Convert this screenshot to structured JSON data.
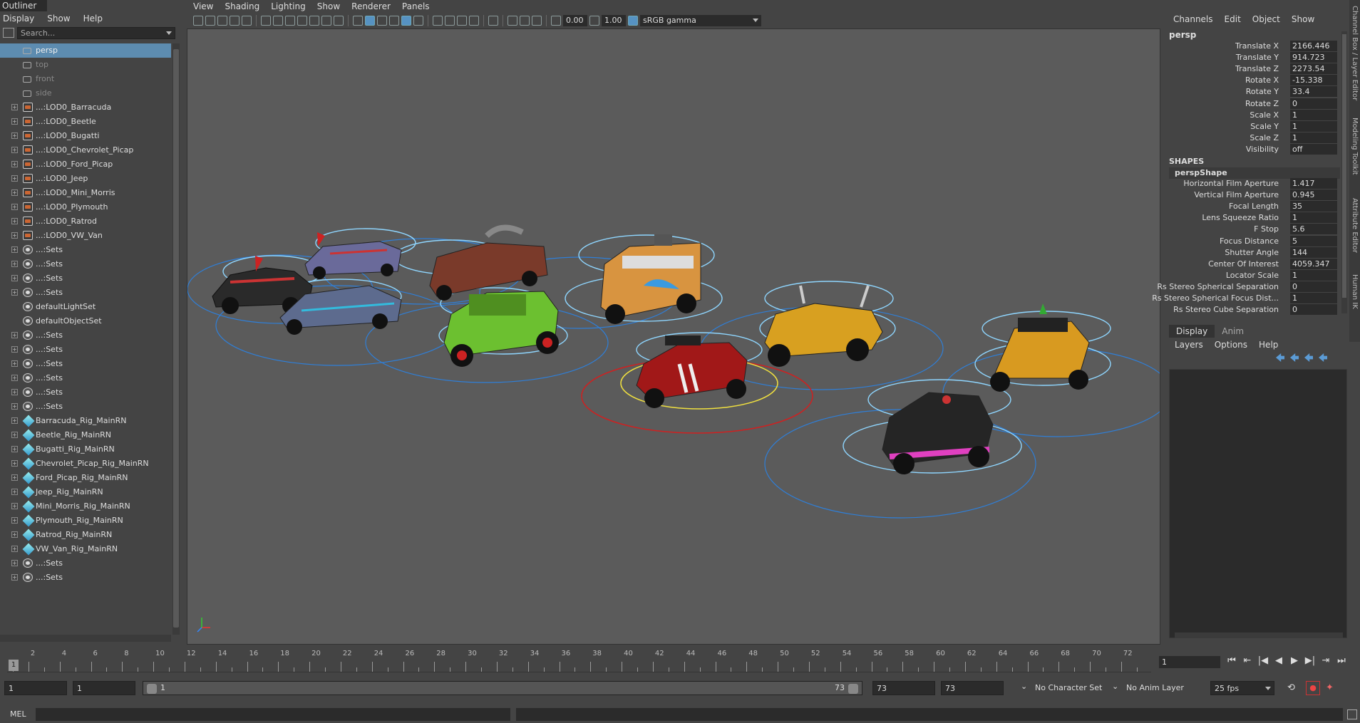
{
  "outliner": {
    "title": "Outliner",
    "menu": [
      "Display",
      "Show",
      "Help"
    ],
    "search_placeholder": "Search...",
    "items": [
      {
        "label": "persp",
        "icon": "camera-icon",
        "expand": false,
        "state": "selected"
      },
      {
        "label": "top",
        "icon": "camera-icon",
        "expand": false,
        "state": "dim"
      },
      {
        "label": "front",
        "icon": "camera-icon",
        "expand": false,
        "state": "dim"
      },
      {
        "label": "side",
        "icon": "camera-icon",
        "expand": false,
        "state": "dim"
      },
      {
        "label": "...:LOD0_Barracuda",
        "icon": "group-icon",
        "expand": true
      },
      {
        "label": "...:LOD0_Beetle",
        "icon": "group-icon",
        "expand": true
      },
      {
        "label": "...:LOD0_Bugatti",
        "icon": "group-icon",
        "expand": true
      },
      {
        "label": "...:LOD0_Chevrolet_Picap",
        "icon": "group-icon",
        "expand": true
      },
      {
        "label": "...:LOD0_Ford_Picap",
        "icon": "group-icon",
        "expand": true
      },
      {
        "label": "...:LOD0_Jeep",
        "icon": "group-icon",
        "expand": true
      },
      {
        "label": "...:LOD0_Mini_Morris",
        "icon": "group-icon",
        "expand": true
      },
      {
        "label": "...:LOD0_Plymouth",
        "icon": "group-icon",
        "expand": true
      },
      {
        "label": "...:LOD0_Ratrod",
        "icon": "group-icon",
        "expand": true
      },
      {
        "label": "...:LOD0_VW_Van",
        "icon": "group-icon",
        "expand": true
      },
      {
        "label": "...:Sets",
        "icon": "set-icon",
        "expand": true
      },
      {
        "label": "...:Sets",
        "icon": "set-icon",
        "expand": true
      },
      {
        "label": "...:Sets",
        "icon": "set-icon",
        "expand": true
      },
      {
        "label": "...:Sets",
        "icon": "set-icon",
        "expand": true
      },
      {
        "label": "defaultLightSet",
        "icon": "set-icon",
        "expand": false
      },
      {
        "label": "defaultObjectSet",
        "icon": "set-icon",
        "expand": false
      },
      {
        "label": "...:Sets",
        "icon": "set-icon",
        "expand": true
      },
      {
        "label": "...:Sets",
        "icon": "set-icon",
        "expand": true
      },
      {
        "label": "...:Sets",
        "icon": "set-icon",
        "expand": true
      },
      {
        "label": "...:Sets",
        "icon": "set-icon",
        "expand": true
      },
      {
        "label": "...:Sets",
        "icon": "set-icon",
        "expand": true
      },
      {
        "label": "...:Sets",
        "icon": "set-icon",
        "expand": true
      },
      {
        "label": "Barracuda_Rig_MainRN",
        "icon": "reference-icon",
        "expand": true
      },
      {
        "label": "Beetle_Rig_MainRN",
        "icon": "reference-icon",
        "expand": true
      },
      {
        "label": "Bugatti_Rig_MainRN",
        "icon": "reference-icon",
        "expand": true
      },
      {
        "label": "Chevrolet_Picap_Rig_MainRN",
        "icon": "reference-icon",
        "expand": true
      },
      {
        "label": "Ford_Picap_Rig_MainRN",
        "icon": "reference-icon",
        "expand": true
      },
      {
        "label": "Jeep_Rig_MainRN",
        "icon": "reference-icon",
        "expand": true
      },
      {
        "label": "Mini_Morris_Rig_MainRN",
        "icon": "reference-icon",
        "expand": true
      },
      {
        "label": "Plymouth_Rig_MainRN",
        "icon": "reference-icon",
        "expand": true
      },
      {
        "label": "Ratrod_Rig_MainRN",
        "icon": "reference-icon",
        "expand": true
      },
      {
        "label": "VW_Van_Rig_MainRN",
        "icon": "reference-icon",
        "expand": true
      },
      {
        "label": "...:Sets",
        "icon": "set-icon",
        "expand": true
      },
      {
        "label": "...:Sets",
        "icon": "set-icon",
        "expand": true
      }
    ]
  },
  "viewport": {
    "menu": [
      "View",
      "Shading",
      "Lighting",
      "Show",
      "Renderer",
      "Panels"
    ],
    "exposure": "0.00",
    "gamma": "1.00",
    "color_space": "sRGB gamma"
  },
  "channel_box": {
    "menu": [
      "Channels",
      "Edit",
      "Object",
      "Show"
    ],
    "node": "persp",
    "attributes": [
      {
        "name": "Translate X",
        "value": "2166.446"
      },
      {
        "name": "Translate Y",
        "value": "914.723"
      },
      {
        "name": "Translate Z",
        "value": "2273.54"
      },
      {
        "name": "Rotate X",
        "value": "-15.338"
      },
      {
        "name": "Rotate Y",
        "value": "33.4"
      },
      {
        "name": "Rotate Z",
        "value": "0"
      },
      {
        "name": "Scale X",
        "value": "1"
      },
      {
        "name": "Scale Y",
        "value": "1"
      },
      {
        "name": "Scale Z",
        "value": "1"
      },
      {
        "name": "Visibility",
        "value": "off"
      }
    ],
    "shapes_label": "SHAPES",
    "shape_node": "perspShape",
    "shape_attributes": [
      {
        "name": "Horizontal Film Aperture",
        "value": "1.417"
      },
      {
        "name": "Vertical Film Aperture",
        "value": "0.945"
      },
      {
        "name": "Focal Length",
        "value": "35"
      },
      {
        "name": "Lens Squeeze Ratio",
        "value": "1"
      },
      {
        "name": "F Stop",
        "value": "5.6"
      },
      {
        "name": "Focus Distance",
        "value": "5"
      },
      {
        "name": "Shutter Angle",
        "value": "144"
      },
      {
        "name": "Center Of Interest",
        "value": "4059.347"
      },
      {
        "name": "Locator Scale",
        "value": "1"
      },
      {
        "name": "Rs Stereo Spherical Separation",
        "value": "0"
      },
      {
        "name": "Rs Stereo Spherical Focus Dist...",
        "value": "1"
      },
      {
        "name": "Rs Stereo Cube Separation",
        "value": "0"
      }
    ]
  },
  "side_tabs": [
    "Channel Box / Layer Editor",
    "Modeling Toolkit",
    "Attribute Editor",
    "Human IK"
  ],
  "layer_editor": {
    "tabs": [
      "Display",
      "Anim"
    ],
    "menu": [
      "Layers",
      "Options",
      "Help"
    ]
  },
  "timeline": {
    "labels": [
      "2",
      "4",
      "6",
      "8",
      "10",
      "12",
      "14",
      "16",
      "18",
      "20",
      "22",
      "24",
      "26",
      "28",
      "30",
      "32",
      "34",
      "36",
      "38",
      "40",
      "42",
      "44",
      "46",
      "48",
      "50",
      "52",
      "54",
      "56",
      "58",
      "60",
      "62",
      "64",
      "66",
      "68",
      "70",
      "72"
    ],
    "current_frame": "1",
    "playback_frame": "1"
  },
  "range": {
    "start": "1",
    "anim_start": "1",
    "slider_start": "1",
    "slider_end": "73",
    "anim_end": "73",
    "end": "73",
    "character_set": "No Character Set",
    "anim_layer": "No Anim Layer",
    "fps": "25 fps"
  },
  "command_line": {
    "mode": "MEL"
  }
}
